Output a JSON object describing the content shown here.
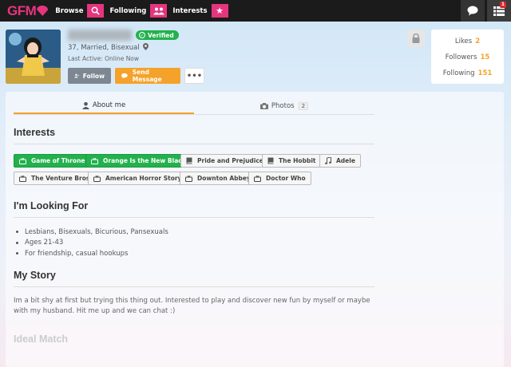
{
  "brand": {
    "logo_text": "GFM",
    "accent": "#e5357e"
  },
  "nav": {
    "items": [
      {
        "label": "Browse",
        "icon": "search-icon"
      },
      {
        "label": "Following",
        "icon": "people-icon"
      },
      {
        "label": "Interests",
        "icon": "star-icon"
      }
    ]
  },
  "topbar": {
    "notifications_badge": "1",
    "icons": [
      "chat-icon",
      "list-icon"
    ]
  },
  "profile": {
    "verified_label": "Verified",
    "info": "37, Married, Bisexual",
    "last_active": "Last Active: Online Now",
    "follow_label": "Follow",
    "message_label": "Send Message",
    "more_label": "•••"
  },
  "stats": [
    {
      "label": "Likes",
      "value": "2"
    },
    {
      "label": "Followers",
      "value": "15"
    },
    {
      "label": "Following",
      "value": "151"
    }
  ],
  "tabs": [
    {
      "label": "About me",
      "icon": "user-icon"
    },
    {
      "label": "Photos",
      "icon": "camera-icon",
      "count": "2"
    }
  ],
  "sections": {
    "interests": "Interests",
    "looking_for": "I'm Looking For",
    "story": "My Story",
    "ideal": "Ideal Match"
  },
  "interests": [
    {
      "label": "Game of Thrones",
      "icon": "tv-icon",
      "highlight": true
    },
    {
      "label": "Orange Is the New Black",
      "icon": "tv-icon",
      "highlight": true
    },
    {
      "label": "Pride and Prejudice",
      "icon": "book-icon",
      "highlight": false
    },
    {
      "label": "The Hobbit",
      "icon": "book-icon",
      "highlight": false
    },
    {
      "label": "Adele",
      "icon": "music-icon",
      "highlight": false
    },
    {
      "label": "The Venture Bros",
      "icon": "tv-icon",
      "highlight": false
    },
    {
      "label": "American Horror Story",
      "icon": "tv-icon",
      "highlight": false
    },
    {
      "label": "Downton Abbey",
      "icon": "tv-icon",
      "highlight": false
    },
    {
      "label": "Doctor Who",
      "icon": "tv-icon",
      "highlight": false
    }
  ],
  "looking_for": [
    "Lesbians, Bisexuals, Bicurious, Pansexuals",
    "Ages 21-43",
    "For friendship, casual hookups"
  ],
  "story": "Im a bit shy at first but trying this thing out. Interested to play and discover new fun by myself or maybe with my husband. Hit me up and we can chat :)"
}
